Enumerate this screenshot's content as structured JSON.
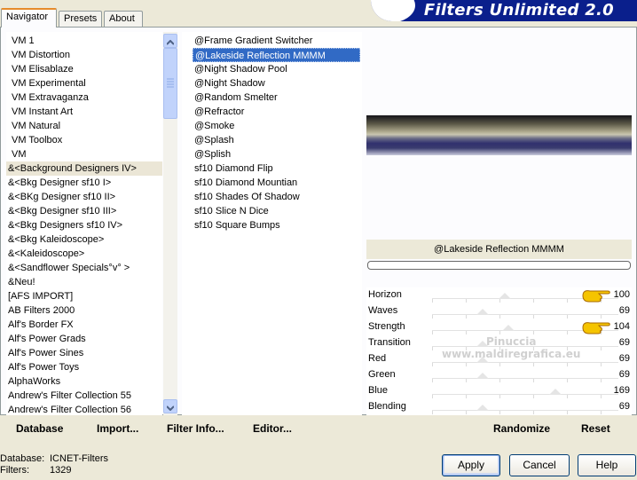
{
  "header": {
    "title": "Filters Unlimited 2.0"
  },
  "tabs": [
    {
      "label": "Navigator",
      "active": true
    },
    {
      "label": "Presets",
      "active": false
    },
    {
      "label": "About",
      "active": false
    }
  ],
  "categories": [
    "VM 1",
    "VM Distortion",
    "VM Elisablaze",
    "VM Experimental",
    "VM Extravaganza",
    "VM Instant Art",
    "VM Natural",
    "VM Toolbox",
    "VM",
    "&<Background Designers IV>",
    "&<Bkg Designer sf10 I>",
    "&<BKg Designer sf10 II>",
    "&<Bkg Designer sf10 III>",
    "&<Bkg Designers sf10 IV>",
    "&<Bkg Kaleidoscope>",
    "&<Kaleidoscope>",
    "&<Sandflower Specials°v° >",
    "&Neu!",
    "[AFS IMPORT]",
    "AB Filters 2000",
    "Alf's Border FX",
    "Alf's Power Grads",
    "Alf's Power Sines",
    "Alf's Power Toys",
    "AlphaWorks",
    "Andrew's Filter Collection 55",
    "Andrew's Filter Collection 56"
  ],
  "selected_category": "&<Background Designers IV>",
  "filters": [
    "@Frame Gradient Switcher",
    "@Lakeside Reflection MMMM",
    "@Night Shadow Pool",
    "@Night Shadow",
    "@Random Smelter",
    "@Refractor",
    "@Smoke",
    "@Splash",
    "@Splish",
    "sf10 Diamond Flip",
    "sf10 Diamond Mountian",
    "sf10 Shades Of Shadow",
    "sf10 Slice N Dice",
    "sf10 Square Bumps"
  ],
  "selected_filter": "@Lakeside Reflection MMMM",
  "preview": {
    "filter_name": "@Lakeside Reflection MMMM"
  },
  "sliders": [
    {
      "label": "Horizon",
      "value": "100",
      "level": 100,
      "pointer": true
    },
    {
      "label": "Waves",
      "value": "69",
      "level": 69,
      "pointer": false
    },
    {
      "label": "Strength",
      "value": "104",
      "level": 104,
      "pointer": true
    },
    {
      "label": "Transition",
      "value": "69",
      "level": 69,
      "pointer": false
    },
    {
      "label": "Red",
      "value": "69",
      "level": 69,
      "pointer": false
    },
    {
      "label": "Green",
      "value": "69",
      "level": 69,
      "pointer": false
    },
    {
      "label": "Blue",
      "value": "169",
      "level": 169,
      "pointer": false
    },
    {
      "label": "Blending",
      "value": "69",
      "level": 69,
      "pointer": false
    }
  ],
  "watermark": {
    "line1": "Pinuccia",
    "line2": "www.maldiregrafica.eu"
  },
  "toolbar": {
    "database_label": "Database",
    "import_label": "Import...",
    "filter_info_label": "Filter Info...",
    "editor_label": "Editor...",
    "randomize_label": "Randomize",
    "reset_label": "Reset"
  },
  "status": {
    "database_key": "Database:",
    "database_value": "ICNET-Filters",
    "filters_key": "Filters:",
    "filters_value": "1329"
  },
  "buttons": {
    "apply": "Apply",
    "cancel": "Cancel",
    "help": "Help"
  },
  "colors": {
    "selection": "#316ac5",
    "banner": "#0a1f8c",
    "tab_accent": "#e68b2c",
    "pointer_hand": "#f5c400"
  }
}
